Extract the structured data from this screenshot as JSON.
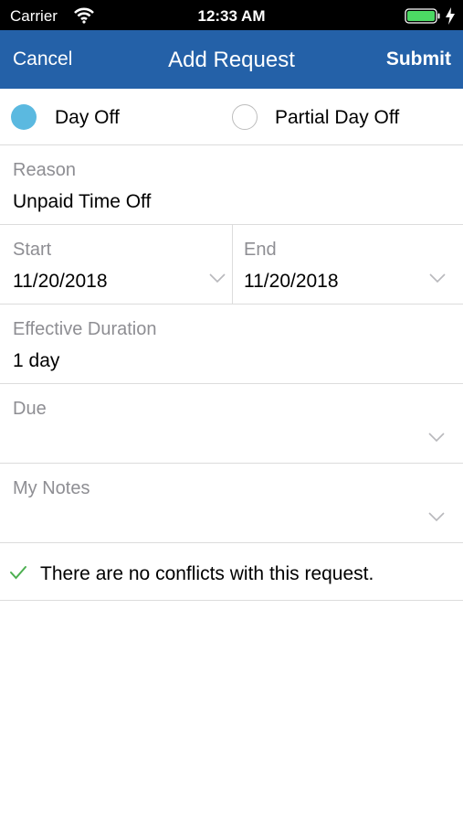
{
  "status_bar": {
    "carrier": "Carrier",
    "time": "12:33 AM",
    "battery_color": "#4cd964"
  },
  "nav": {
    "cancel_label": "Cancel",
    "title": "Add Request",
    "submit_label": "Submit",
    "bar_color": "#2461a8"
  },
  "request_type": {
    "options": [
      {
        "label": "Day Off",
        "selected": true
      },
      {
        "label": "Partial Day Off",
        "selected": false
      }
    ],
    "selected_color": "#5bb9e0"
  },
  "reason": {
    "label": "Reason",
    "value": "Unpaid Time Off"
  },
  "start": {
    "label": "Start",
    "value": "11/20/2018"
  },
  "end": {
    "label": "End",
    "value": "11/20/2018"
  },
  "effective_duration": {
    "label": "Effective Duration",
    "value": "1 day"
  },
  "due": {
    "label": "Due",
    "value": ""
  },
  "my_notes": {
    "label": "My Notes",
    "value": ""
  },
  "conflicts": {
    "icon": "checkmark-icon",
    "message": "There are no conflicts with this request.",
    "icon_color": "#4caf50"
  }
}
